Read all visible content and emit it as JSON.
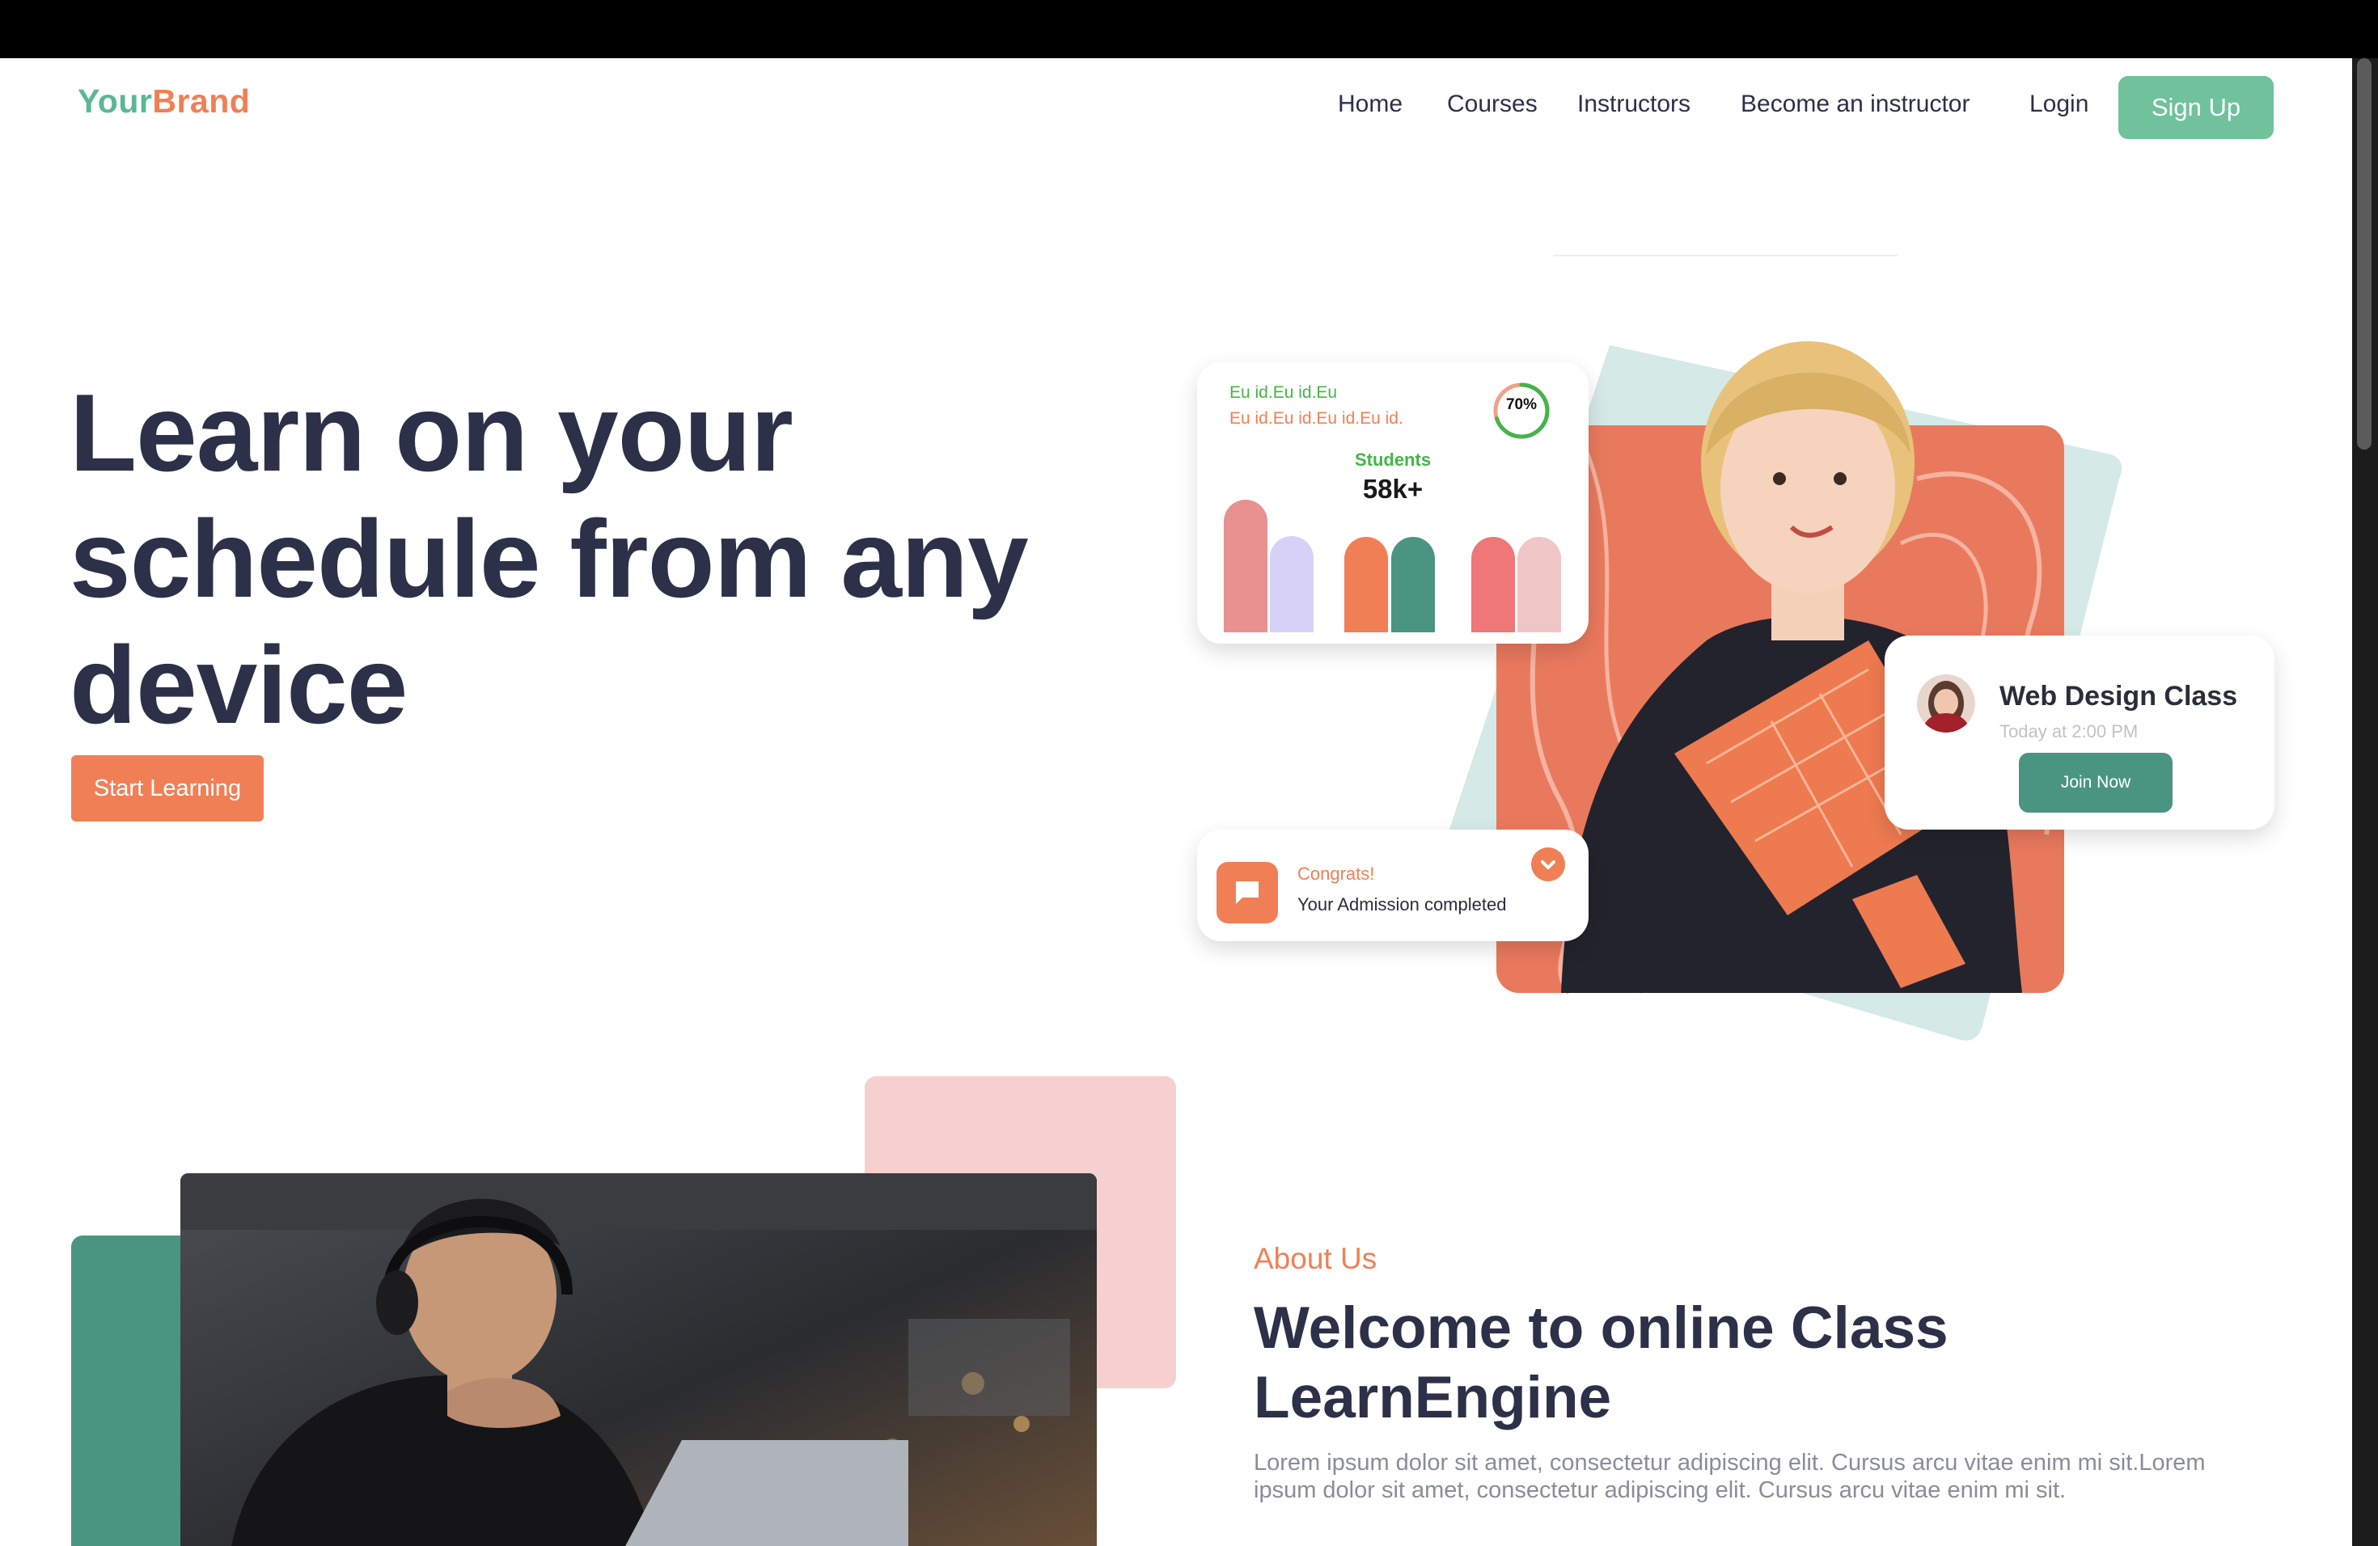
{
  "brand": {
    "part1": "Your",
    "part2": "Brand"
  },
  "nav": {
    "items": [
      "Home",
      "Courses",
      "Instructors",
      "Become an instructor",
      "Login"
    ],
    "signup_label": "Sign Up"
  },
  "hero": {
    "title": "Learn on your schedule from any device",
    "cta_label": "Start Learning"
  },
  "stats_card": {
    "line1": "Eu id.Eu id.Eu",
    "line2": "Eu id.Eu id.Eu id.Eu id.",
    "progress_percent": 70,
    "progress_label": "70%",
    "students_label": "Students",
    "students_value": "58k+",
    "bar_colors": [
      "#e99191",
      "#d8d1f7",
      "#f17f56",
      "#4a9582",
      "#ef7777",
      "#f0c5c5"
    ]
  },
  "class_card": {
    "title": "Web Design Class",
    "subtitle": "Today at 2:00 PM",
    "join_label": "Join Now"
  },
  "congrats_card": {
    "title": "Congrats!",
    "subtitle": "Your Admission completed"
  },
  "about": {
    "label": "About Us",
    "title": "Welcome to online Class LearnEngine",
    "body": "Lorem ipsum dolor sit amet, consectetur adipiscing elit. Cursus arcu vitae enim mi sit.Lorem ipsum dolor sit amet, consectetur adipiscing elit. Cursus arcu vitae enim mi sit."
  },
  "colors": {
    "brand_green": "#5bb795",
    "brand_orange": "#f17f56",
    "navy_text": "#2c3048",
    "teal": "#4a9582",
    "mint": "#d5e9e6",
    "pink": "#f6d0d0"
  }
}
